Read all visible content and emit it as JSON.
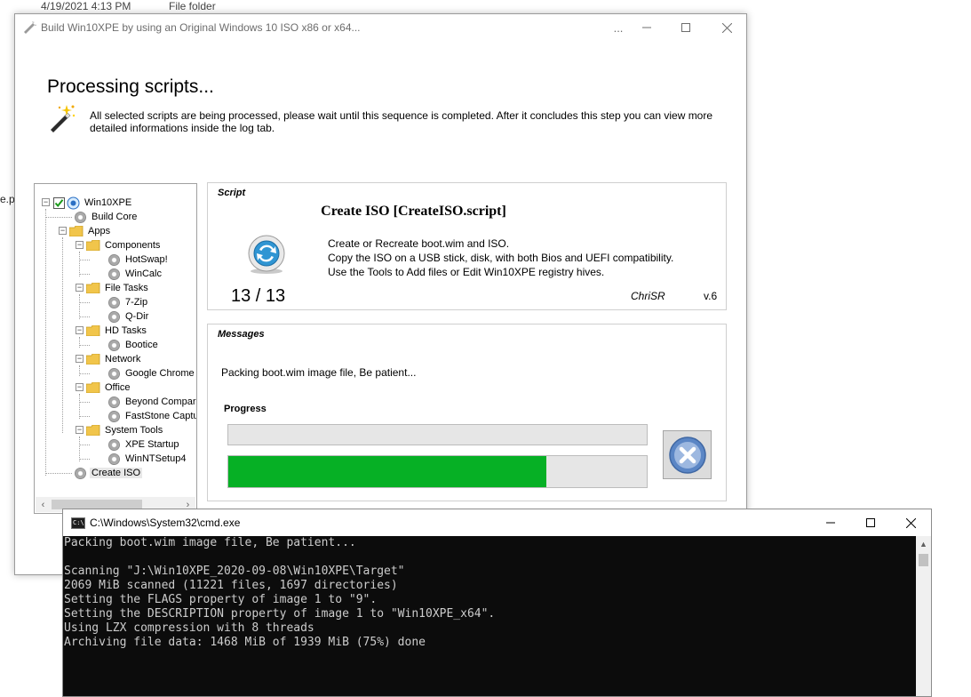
{
  "background": {
    "date_text": "4/19/2021 4:13 PM",
    "type_text": "File folder",
    "edge_text": "e.p"
  },
  "main_window": {
    "title": "Build Win10XPE by using an Original Windows 10 ISO x86 or x64...",
    "extra_button": "...",
    "heading": "Processing scripts...",
    "description": "All selected scripts are being processed, please wait until this sequence is completed. After it concludes this step you can view more detailed informations inside the log tab."
  },
  "tree": {
    "root": "Win10XPE",
    "build_core": "Build Core",
    "apps": "Apps",
    "components": "Components",
    "hotswap": "HotSwap!",
    "wincalc": "WinCalc",
    "file_tasks": "File Tasks",
    "zip": "7-Zip",
    "qdir": "Q-Dir",
    "hd_tasks": "HD Tasks",
    "bootice": "Bootice",
    "network": "Network",
    "chrome": "Google Chrome v",
    "office": "Office",
    "beyond": "Beyond Compare",
    "faststone": "FastStone Captu",
    "system_tools": "System Tools",
    "xpe_startup": "XPE Startup",
    "winnt": "WinNTSetup4",
    "create_iso": "Create ISO"
  },
  "script_panel": {
    "label": "Script",
    "title": "Create ISO [CreateISO.script]",
    "desc_lines": [
      "Create or Recreate boot.wim and ISO.",
      "Copy the ISO on a USB stick, disk, with both Bios and UEFI compatibility.",
      "Use the Tools to Add files or Edit Win10XPE registry hives."
    ],
    "counter": "13 / 13",
    "author": "ChriSR",
    "version": "v.6"
  },
  "messages_panel": {
    "label": "Messages",
    "message": "Packing boot.wim image file, Be patient...",
    "progress_label": "Progress",
    "progress_1": 0,
    "progress_2": 0.76
  },
  "cmd": {
    "title": "C:\\Windows\\System32\\cmd.exe",
    "lines": [
      "Packing boot.wim image file, Be patient...",
      "",
      "Scanning \"J:\\Win10XPE_2020-09-08\\Win10XPE\\Target\"",
      "2069 MiB scanned (11221 files, 1697 directories)",
      "Setting the FLAGS property of image 1 to \"9\".",
      "Setting the DESCRIPTION property of image 1 to \"Win10XPE_x64\".",
      "Using LZX compression with 8 threads",
      "Archiving file data: 1468 MiB of 1939 MiB (75%) done"
    ]
  },
  "colors": {
    "progress_green": "#06b025",
    "console_bg": "#0c0c0c",
    "console_fg": "#cccccc"
  }
}
